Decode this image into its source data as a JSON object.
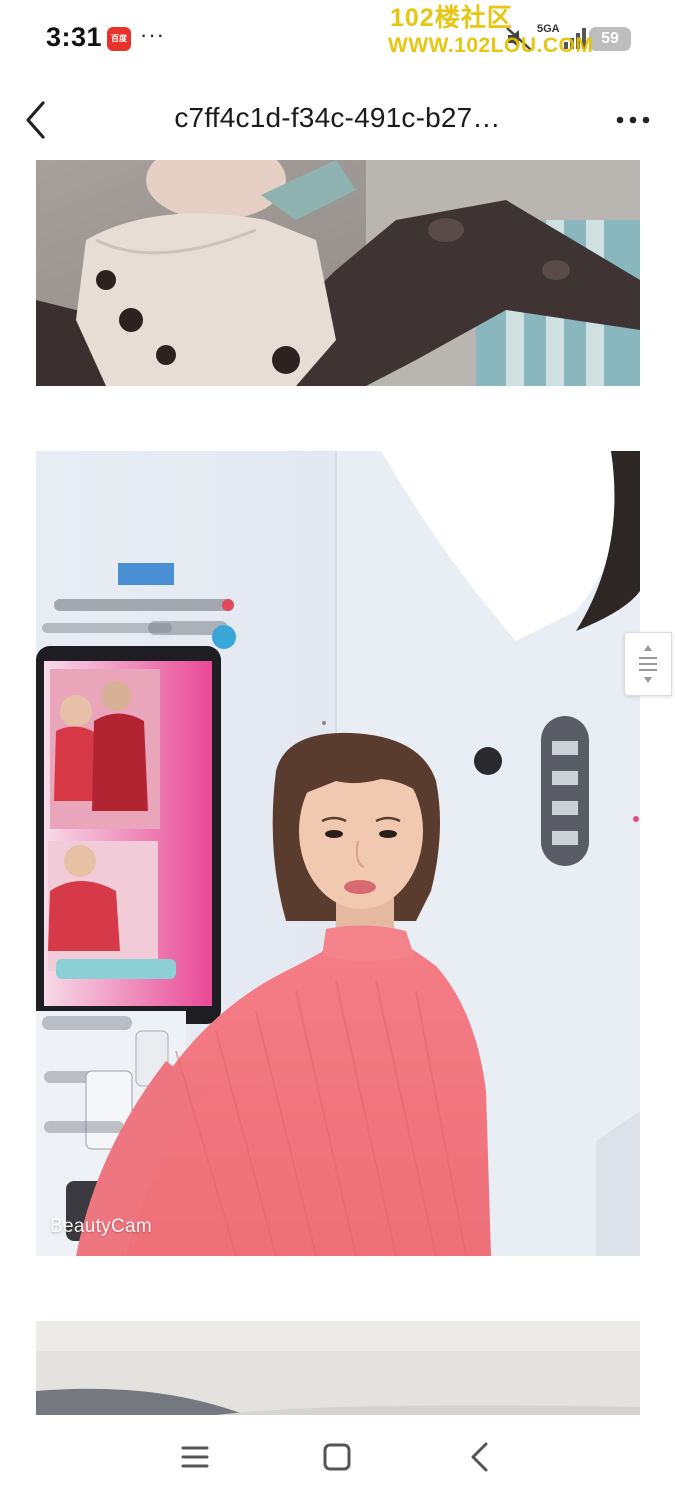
{
  "status_bar": {
    "time": "3:31",
    "app_badge": "百度",
    "more": "···",
    "network": "5GA",
    "battery": "59"
  },
  "watermark": {
    "line1": "102楼社区",
    "line2": "WWW.102LOU.COM"
  },
  "header": {
    "title": "c7ff4c1d-f34c-491c-b27…"
  },
  "photos": [
    {
      "caption": ""
    },
    {
      "caption": "BeautyCam"
    },
    {
      "caption": ""
    }
  ],
  "icons": {
    "back": "chevron-left-icon",
    "more": "more-horizontal-icon",
    "scroll": "scroll-handle-icon",
    "nav_menu": "recent-apps-icon",
    "nav_home": "home-square-icon",
    "nav_back": "back-triangle-icon"
  },
  "colors": {
    "watermark": "#e6c200",
    "app_badge": "#e8322a",
    "sweater": "#f07a82",
    "background": "#ffffff"
  }
}
